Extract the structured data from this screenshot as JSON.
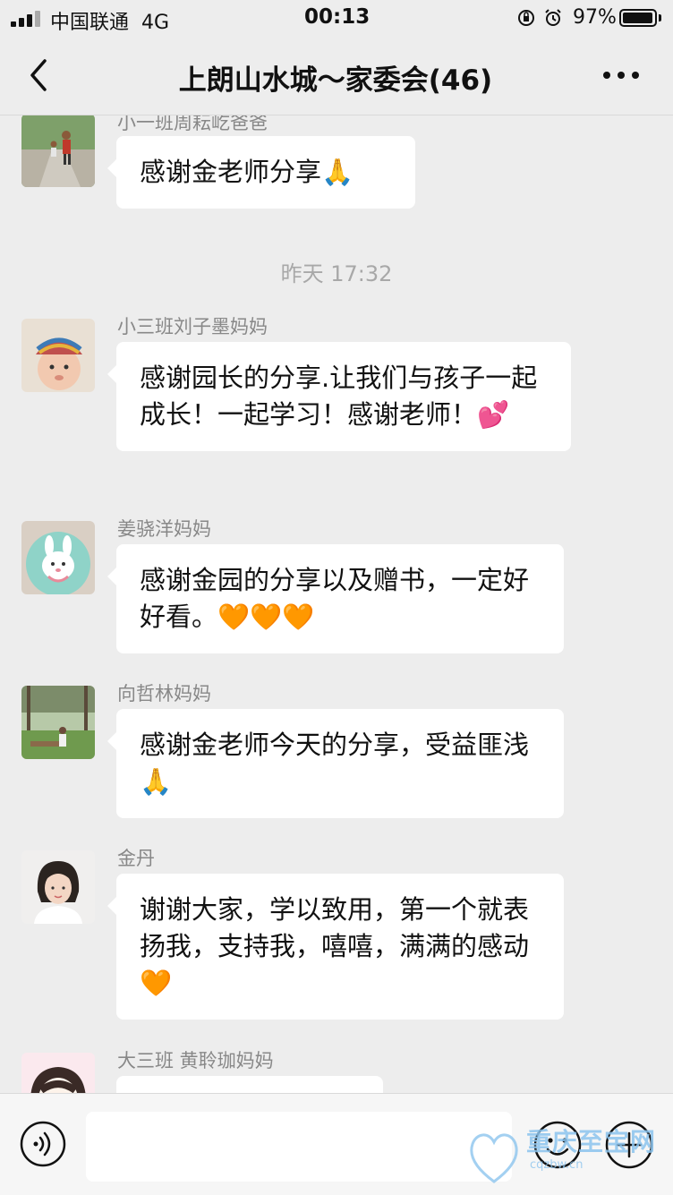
{
  "status_bar": {
    "carrier": "中国联通",
    "network": "4G",
    "time": "00:13",
    "battery_percent": "97%",
    "battery_level": 0.97
  },
  "nav": {
    "title": "上朗山水城～家委会(46)",
    "back_icon": "chevron-left-icon",
    "more_icon": "more-dots-icon"
  },
  "chat": {
    "time_divider": "昨天 17:32",
    "messages": [
      {
        "sender": "小一班周耘屹爸爸",
        "text": "感谢金老师分享",
        "emoji": "🙏"
      },
      {
        "sender": "小三班刘子墨妈妈",
        "text": "感谢园长的分享.让我们与孩子一起成长！一起学习！感谢老师！",
        "emoji": "💕"
      },
      {
        "sender": "姜骁洋妈妈",
        "text": "感谢金园的分享以及赠书，一定好好看。",
        "emoji": "🧡🧡🧡"
      },
      {
        "sender": "向哲林妈妈",
        "text": "感谢金老师今天的分享，受益匪浅",
        "emoji": "🙏"
      },
      {
        "sender": "金丹",
        "text": "谢谢大家，学以致用，第一个就表扬我，支持我，嘻嘻，满满的感动",
        "emoji": "🧡"
      },
      {
        "sender": "大三班 黄聆珈妈妈",
        "text": "",
        "emoji": ""
      }
    ]
  },
  "input_bar": {
    "voice_icon": "voice-icon",
    "emoji_icon": "emoji-icon",
    "plus_icon": "plus-icon",
    "input_value": ""
  },
  "watermark": {
    "text": "重庆至宝网",
    "sub": "cqzbw.cn"
  }
}
